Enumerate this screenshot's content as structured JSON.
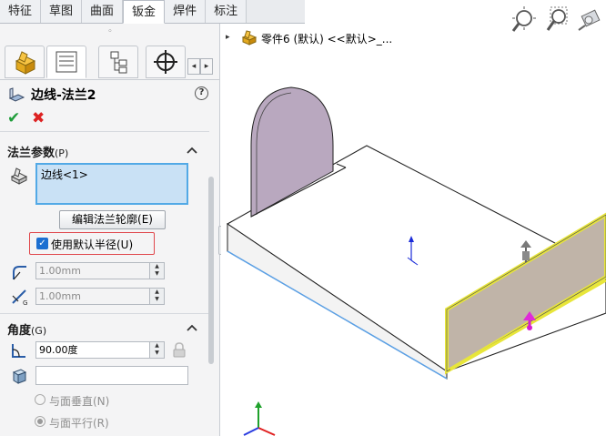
{
  "command_tabs": [
    "特征",
    "草图",
    "曲面",
    "钣金",
    "焊件",
    "标注"
  ],
  "active_tab": "钣金",
  "grip": "◦",
  "feature": {
    "title": "边线-法兰2",
    "help": "?"
  },
  "actions": {
    "ok": "✔",
    "cancel": "✖"
  },
  "flange_params": {
    "title": "法兰参数",
    "title_key": "(P)",
    "edge_list_value": "边线<1>",
    "edit_profile_button": "编辑法兰轮廓(E)",
    "use_default_radius_label": "使用默认半径(U)",
    "use_default_radius_checked": true,
    "radius_value": "1.00mm",
    "gap_value": "1.00mm"
  },
  "angle": {
    "title": "角度",
    "title_key": "(G)",
    "angle_value": "90.00度",
    "face_value": "",
    "radio_perpendicular": "与面垂直(N)",
    "radio_parallel": "与面平行(R)"
  },
  "tree": {
    "expander": "▸",
    "label": "零件6 (默认) <<默认>_..."
  },
  "colors": {
    "accent": "#52a9e6",
    "highlight_box": "#e0474c",
    "flange_fill": "#bba8c0",
    "edge_preview": "#e8e63a"
  }
}
